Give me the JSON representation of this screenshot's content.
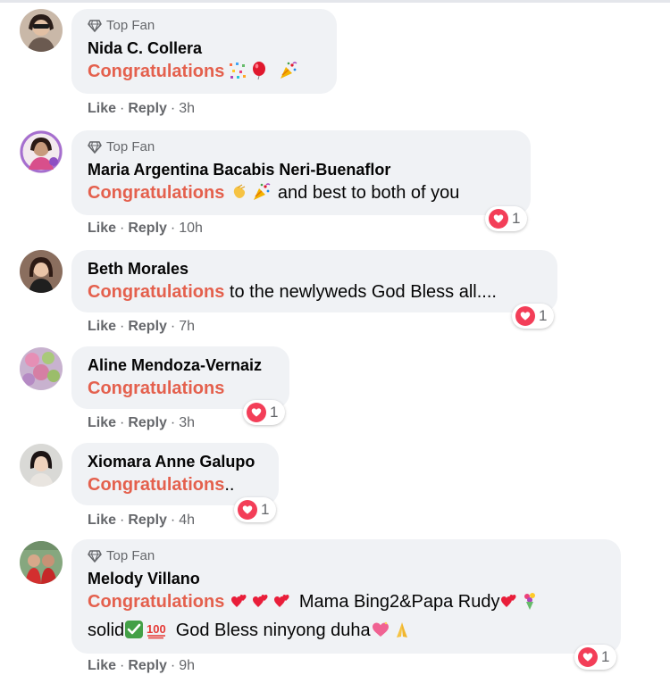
{
  "comments": [
    {
      "badge": "Top Fan",
      "name": "Nida C. Collera",
      "highlight": "Congratulations",
      "rest_lines": [
        ""
      ],
      "emojis_line1": [
        "confetti-icon",
        "balloon-icon",
        "party-popper-icon"
      ],
      "actions": {
        "like": "Like",
        "reply": "Reply",
        "time": "3h"
      },
      "reaction_count": ""
    },
    {
      "badge": "Top Fan",
      "name": "Maria Argentina Bacabis Neri-Buenaflor",
      "highlight": "Congratulations",
      "rest_lines": [
        " and best to both of you"
      ],
      "emojis_line1": [
        "clapping-hands-icon",
        "party-popper-icon"
      ],
      "actions": {
        "like": "Like",
        "reply": "Reply",
        "time": "10h"
      },
      "reaction_count": "1"
    },
    {
      "badge": "",
      "name": "Beth Morales",
      "highlight": "Congratulations",
      "rest_lines": [
        " to the newlyweds God Bless all...."
      ],
      "actions": {
        "like": "Like",
        "reply": "Reply",
        "time": "7h"
      },
      "reaction_count": "1"
    },
    {
      "badge": "",
      "name": "Aline Mendoza-Vernaiz",
      "highlight": "Congratulations",
      "rest_lines": [
        ""
      ],
      "actions": {
        "like": "Like",
        "reply": "Reply",
        "time": "3h"
      },
      "reaction_count": "1"
    },
    {
      "badge": "",
      "name": "Xiomara Anne Galupo",
      "highlight": "Congratulations",
      "rest_lines": [
        ".."
      ],
      "actions": {
        "like": "Like",
        "reply": "Reply",
        "time": "4h"
      },
      "reaction_count": "1"
    },
    {
      "badge": "Top Fan",
      "name": "Melody Villano",
      "highlight": "Congratulations",
      "line1_rest": " Mama Bing2&Papa Rudy",
      "line2_a": "solid",
      "line2_b": " God Bless ninyong duha",
      "actions": {
        "like": "Like",
        "reply": "Reply",
        "time": "9h"
      },
      "reaction_count": "1"
    }
  ],
  "colors": {
    "highlight": "#e4604d",
    "bubble": "#f0f2f5",
    "meta": "#65676b",
    "heart": "#f33e58"
  }
}
